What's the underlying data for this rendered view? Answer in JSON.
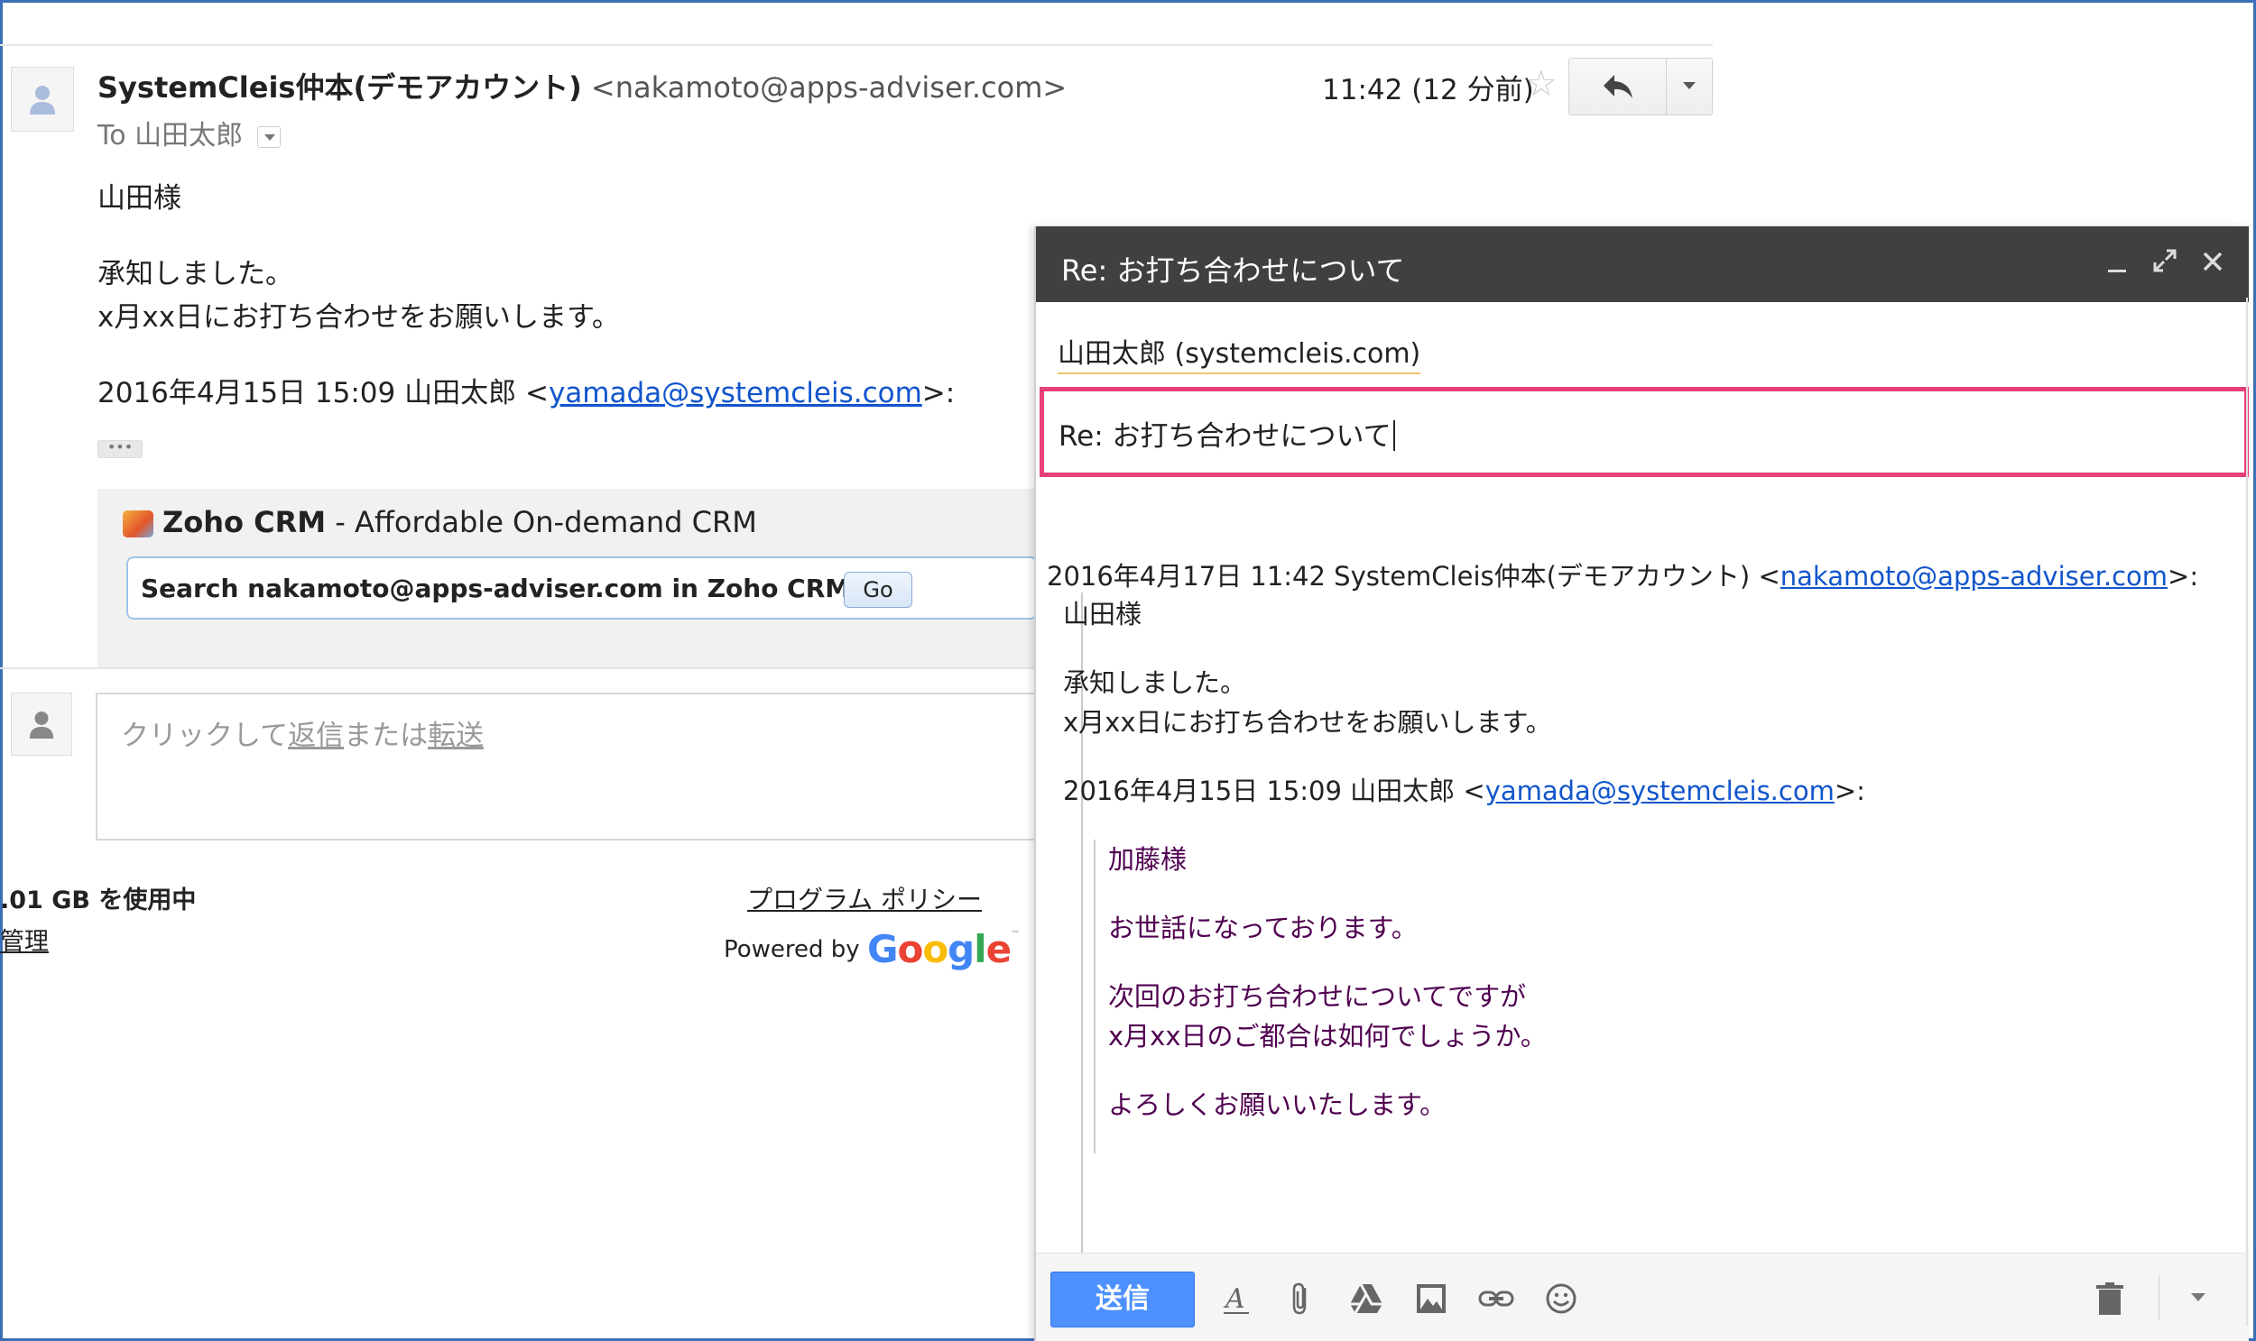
{
  "message": {
    "sender_name": "SystemCleis仲本(デモアカウント)",
    "sender_email": "<nakamoto@apps-adviser.com>",
    "to_label": "To",
    "to_name": "山田太郎",
    "time": "11:42 (12 分前)",
    "body": {
      "greeting": "山田様",
      "line1": "承知しました。",
      "line2": "x月xx日にお打ち合わせをお願いします。",
      "quote_prefix": "2016年4月15日 15:09 山田太郎 <",
      "quote_email": "yamada@systemcleis.com",
      "quote_suffix": ">:"
    },
    "ellipsis": "•••"
  },
  "zoho": {
    "name": "Zoho CRM",
    "tagline": " - Affordable On-demand CRM",
    "search_label": "Search nakamoto@apps-adviser.com in Zoho CRM",
    "go_label": "Go"
  },
  "reply_box": {
    "hint_prefix": "クリックして",
    "reply_link": "返信",
    "hint_middle": "または",
    "forward_link": "転送"
  },
  "footer": {
    "storage": ".01 GB を使用中",
    "manage": "管理",
    "policy": "プログラム ポリシー",
    "powered_by": "Powered by",
    "google": "Google",
    "tm": "™"
  },
  "compose": {
    "title": "Re: お打ち合わせについて",
    "recipient": "山田太郎 (systemcleis.com)",
    "subject": "Re: お打ち合わせについて",
    "quote_header_prefix": "2016年4月17日 11:42 SystemCleis仲本(デモアカウント) <",
    "quote_header_email": "nakamoto@apps-adviser.com",
    "quote_header_suffix": ">:",
    "q_greeting": "山田様",
    "q_line1": "承知しました。",
    "q_line2": "x月xx日にお打ち合わせをお願いします。",
    "q2_prefix": "2016年4月15日 15:09 山田太郎 <",
    "q2_email": "yamada@systemcleis.com",
    "q2_suffix": ">:",
    "qq_greeting": "加藤様",
    "qq_line1": "お世話になっております。",
    "qq_line2": "次回のお打ち合わせについてですが",
    "qq_line3": "x月xx日のご都合は如何でしょうか。",
    "qq_line4": "よろしくお願いいたします。",
    "send_label": "送信",
    "format_icon_label": "A"
  },
  "colors": {
    "accent_send": "#4d90fe",
    "compose_header": "#404040",
    "subject_highlight": "#e8407a",
    "link": "#1155cc",
    "quoted_text": "#500050"
  },
  "icons": [
    "person-icon",
    "star-icon",
    "reply-icon",
    "more-icon",
    "minimize-icon",
    "expand-icon",
    "close-icon",
    "format-icon",
    "attach-icon",
    "drive-icon",
    "photo-icon",
    "link-icon",
    "emoji-icon",
    "trash-icon"
  ]
}
